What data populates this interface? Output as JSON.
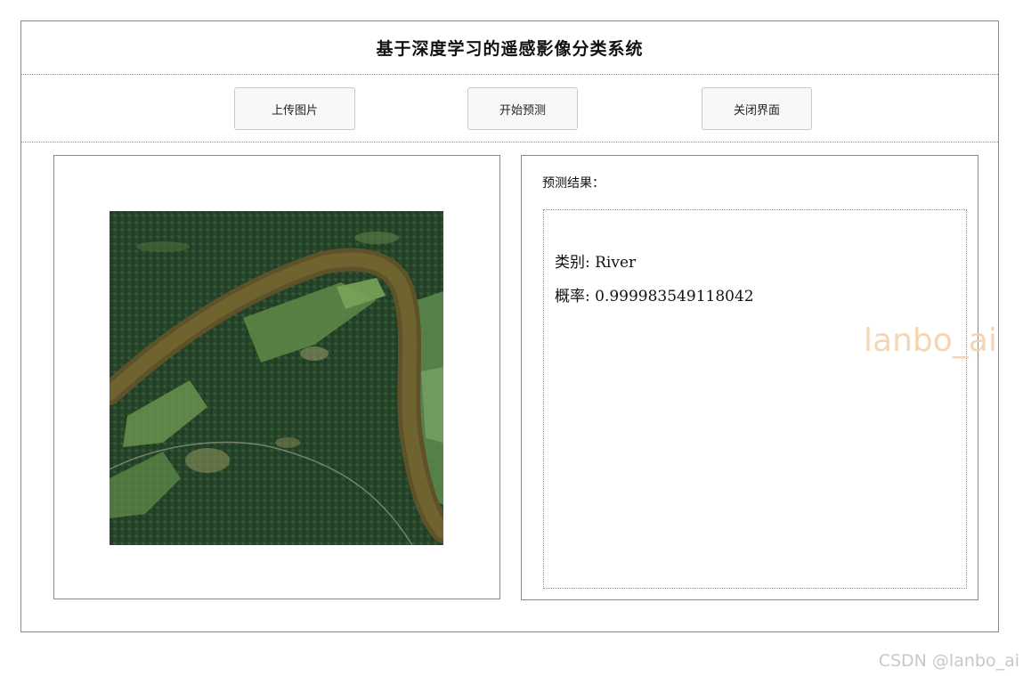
{
  "window": {
    "title": "基于深度学习的遥感影像分类系统"
  },
  "toolbar": {
    "upload_label": "上传图片",
    "predict_label": "开始预测",
    "close_label": "关闭界面"
  },
  "result": {
    "heading": "预测结果：",
    "category_line": "类别: River",
    "probability_line": "概率: 0.999983549118042"
  },
  "image": {
    "subject": "satellite-river-image"
  },
  "watermarks": {
    "overlay": "lanbo_ai",
    "footer": "CSDN @lanbo_ai"
  },
  "colors": {
    "forest": "#2b4a2a",
    "river": "#6b5a2a",
    "field": "#6f9a52",
    "watermark": "#f3cfa8"
  }
}
